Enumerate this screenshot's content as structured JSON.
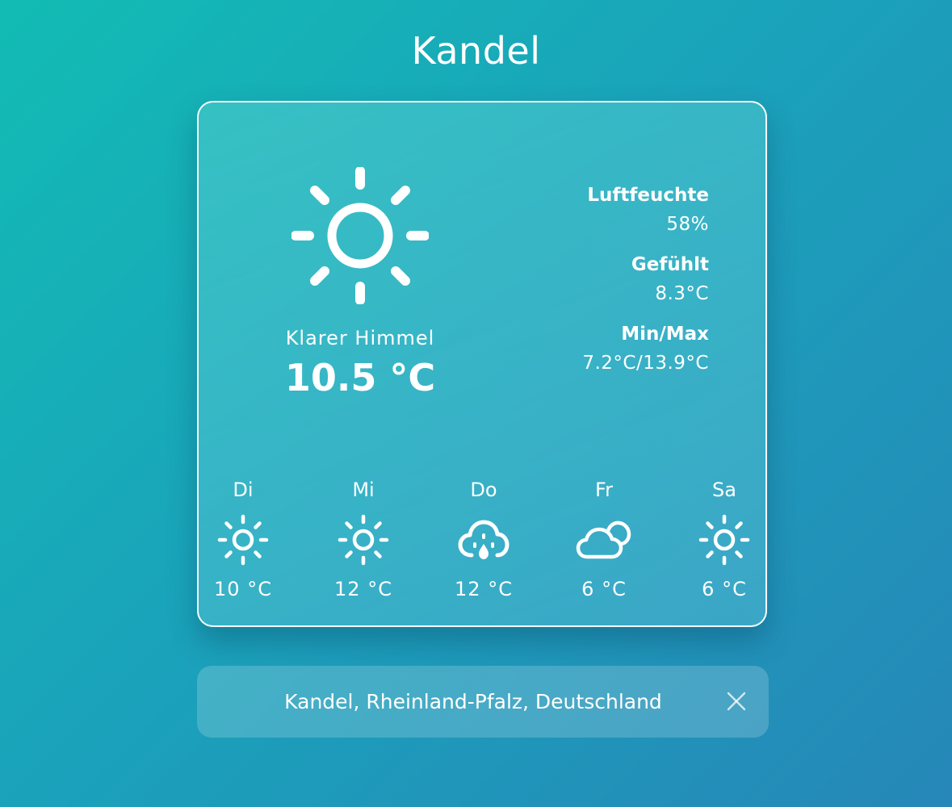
{
  "header": {
    "city": "Kandel"
  },
  "current": {
    "icon": "sun-icon",
    "description": "Klarer Himmel",
    "temperature": "10.5 °C"
  },
  "details": [
    {
      "label": "Luftfeuchte",
      "value": "58%"
    },
    {
      "label": "Gefühlt",
      "value": "8.3°C"
    },
    {
      "label": "Min/Max",
      "value": "7.2°C/13.9°C"
    }
  ],
  "forecast": [
    {
      "day": "Di",
      "icon": "sun-icon",
      "temp": "10 °C"
    },
    {
      "day": "Mi",
      "icon": "sun-icon",
      "temp": "12 °C"
    },
    {
      "day": "Do",
      "icon": "cloud-rain-icon",
      "temp": "12 °C"
    },
    {
      "day": "Fr",
      "icon": "cloud-icon",
      "temp": "6 °C"
    },
    {
      "day": "Sa",
      "icon": "sun-icon",
      "temp": "6 °C"
    }
  ],
  "search": {
    "value": "Kandel, Rheinland-Pfalz, Deutschland",
    "clear_icon": "close-icon"
  },
  "colors": {
    "background_start": "#12bcb4",
    "background_end": "#2687b8",
    "text": "#ffffff"
  }
}
